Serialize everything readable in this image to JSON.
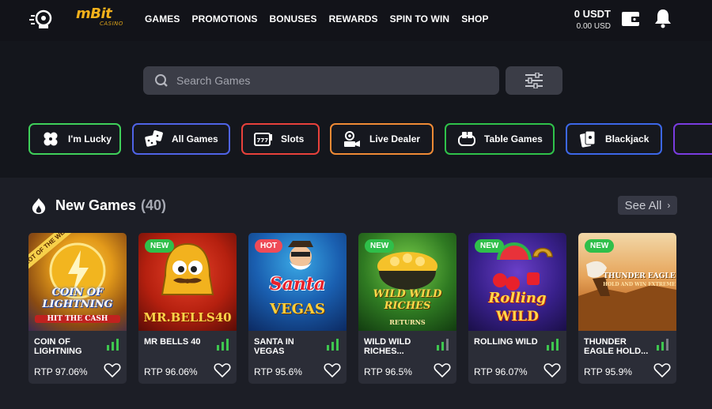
{
  "header": {
    "logo_main": "mBit",
    "logo_sub": "CASINO",
    "nav": [
      "GAMES",
      "PROMOTIONS",
      "BONUSES",
      "REWARDS",
      "SPIN TO WIN",
      "SHOP"
    ],
    "balance_primary": "0 USDT",
    "balance_secondary": "0.00 USD"
  },
  "search": {
    "placeholder": "Search Games"
  },
  "categories": [
    {
      "label": "I'm Lucky",
      "icon": "clover-icon",
      "color": "#3fd05a"
    },
    {
      "label": "All Games",
      "icon": "dice-icon",
      "color": "#4f63e6"
    },
    {
      "label": "Slots",
      "icon": "slot-machine-icon",
      "color": "#e8413b"
    },
    {
      "label": "Live Dealer",
      "icon": "live-camera-icon",
      "color": "#ef8a35"
    },
    {
      "label": "Table Games",
      "icon": "table-game-icon",
      "color": "#2fc24a"
    },
    {
      "label": "Blackjack",
      "icon": "cards-icon",
      "color": "#3c67e8"
    }
  ],
  "section": {
    "title": "New Games",
    "count": "(40)",
    "see_all": "See All"
  },
  "games": [
    {
      "name": "COIN OF LIGHTNING",
      "rtp": "RTP 97.06%",
      "badge": "",
      "art_text": "COIN OF LIGHTNING",
      "art_sub": "HIT THE CASH",
      "ribbon": "SLOT OF THE WEEK"
    },
    {
      "name": "MR BELLS 40",
      "rtp": "RTP 96.06%",
      "badge": "NEW",
      "art_text": "MR.BELLS40",
      "art_sub": "",
      "ribbon": ""
    },
    {
      "name": "SANTA IN VEGAS",
      "rtp": "RTP 95.6%",
      "badge": "HOT",
      "art_text": "Santa",
      "art_sub": "VEGAS",
      "ribbon": ""
    },
    {
      "name": "WILD WILD RICHES...",
      "rtp": "RTP 96.5%",
      "badge": "NEW",
      "art_text": "WILD WILD RICHES",
      "art_sub": "RETURNS",
      "ribbon": ""
    },
    {
      "name": "ROLLING WILD",
      "rtp": "RTP 96.07%",
      "badge": "NEW",
      "art_text": "Rolling",
      "art_sub": "WILD",
      "ribbon": ""
    },
    {
      "name": "THUNDER EAGLE HOLD...",
      "rtp": "RTP 95.9%",
      "badge": "NEW",
      "art_text": "THUNDER EAGLE",
      "art_sub": "HOLD AND WIN EXTREME",
      "ribbon": ""
    }
  ],
  "colors": {
    "accent_green": "#3ec74f",
    "badge_new": "#2fbf4a",
    "badge_hot": "#ef4b57",
    "logo_gold": "#f3b11b"
  }
}
